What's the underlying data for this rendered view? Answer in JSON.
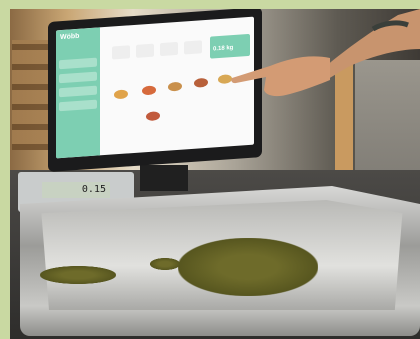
{
  "screen": {
    "logo": "Wöbb",
    "weight_display": "0.18 kg"
  },
  "scale": {
    "display_value": "0.15"
  }
}
